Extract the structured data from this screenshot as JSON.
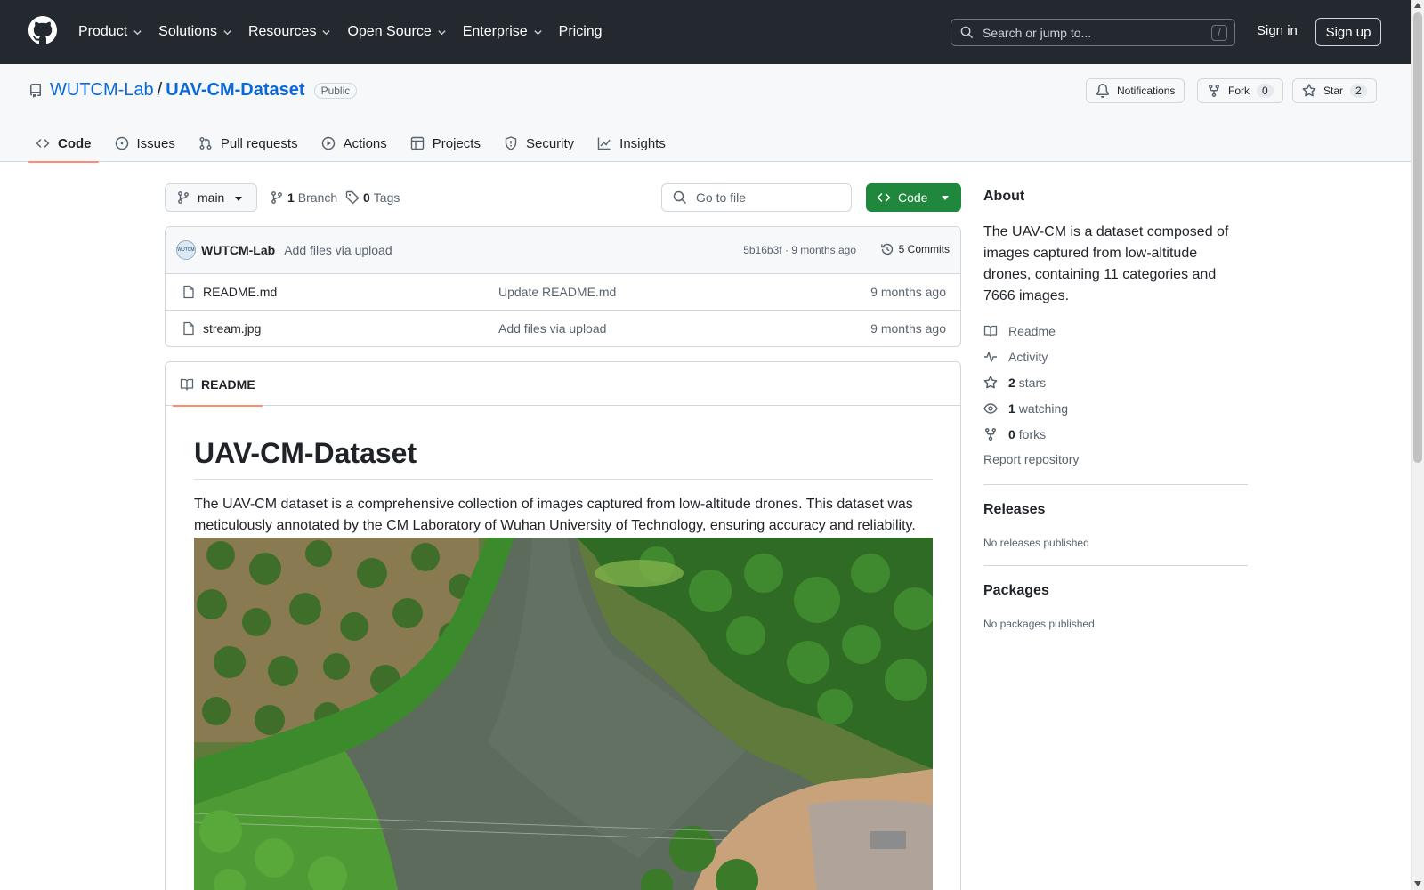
{
  "header": {
    "nav": [
      {
        "label": "Product",
        "dropdown": true
      },
      {
        "label": "Solutions",
        "dropdown": true
      },
      {
        "label": "Resources",
        "dropdown": true
      },
      {
        "label": "Open Source",
        "dropdown": true
      },
      {
        "label": "Enterprise",
        "dropdown": true
      },
      {
        "label": "Pricing",
        "dropdown": false
      }
    ],
    "search_placeholder": "Search or jump to...",
    "search_shortcut": "/",
    "sign_in": "Sign in",
    "sign_up": "Sign up"
  },
  "repo": {
    "owner": "WUTCM-Lab",
    "separator": "/",
    "name": "UAV-CM-Dataset",
    "visibility": "Public",
    "notifications_label": "Notifications",
    "fork_label": "Fork",
    "fork_count": "0",
    "star_label": "Star",
    "star_count": "2",
    "tabs": [
      {
        "label": "Code",
        "icon": "code-icon"
      },
      {
        "label": "Issues",
        "icon": "issue-icon"
      },
      {
        "label": "Pull requests",
        "icon": "pull-request-icon"
      },
      {
        "label": "Actions",
        "icon": "play-icon"
      },
      {
        "label": "Projects",
        "icon": "table-icon"
      },
      {
        "label": "Security",
        "icon": "shield-icon"
      },
      {
        "label": "Insights",
        "icon": "graph-icon"
      }
    ]
  },
  "toolbar": {
    "branch": "main",
    "branch_count": "1",
    "branch_label": "Branch",
    "tag_count": "0",
    "tag_label": "Tags",
    "goto_placeholder": "Go to file",
    "code_button": "Code"
  },
  "commit": {
    "avatar_text": "WUTCM",
    "author": "WUTCM-Lab",
    "message": "Add files via upload",
    "hash_time": "5b16b3f · 9 months ago",
    "commits": "5 Commits"
  },
  "files": [
    {
      "name": "README.md",
      "message": "Update README.md",
      "time": "9 months ago"
    },
    {
      "name": "stream.jpg",
      "message": "Add files via upload",
      "time": "9 months ago"
    }
  ],
  "readme": {
    "tab": "README",
    "title": "UAV-CM-Dataset",
    "paragraph": "The UAV-CM dataset is a comprehensive collection of images captured from low-altitude drones. This dataset was meticulously annotated by the CM Laboratory of Wuhan University of Technology, ensuring accuracy and reliability."
  },
  "about": {
    "heading": "About",
    "description": "The UAV-CM is a dataset composed of images captured from low-altitude drones, containing 11 categories and 7666 images.",
    "readme": "Readme",
    "activity": "Activity",
    "stars_count": "2",
    "stars_label": "stars",
    "watching_count": "1",
    "watching_label": "watching",
    "forks_count": "0",
    "forks_label": "forks",
    "report": "Report repository",
    "releases_heading": "Releases",
    "releases_text": "No releases published",
    "packages_heading": "Packages",
    "packages_text": "No packages published"
  },
  "colors": {
    "header_bg": "#24292f",
    "link": "#0969da",
    "primary_button": "#1f883d",
    "active_tab_underline": "#fd8c73"
  }
}
